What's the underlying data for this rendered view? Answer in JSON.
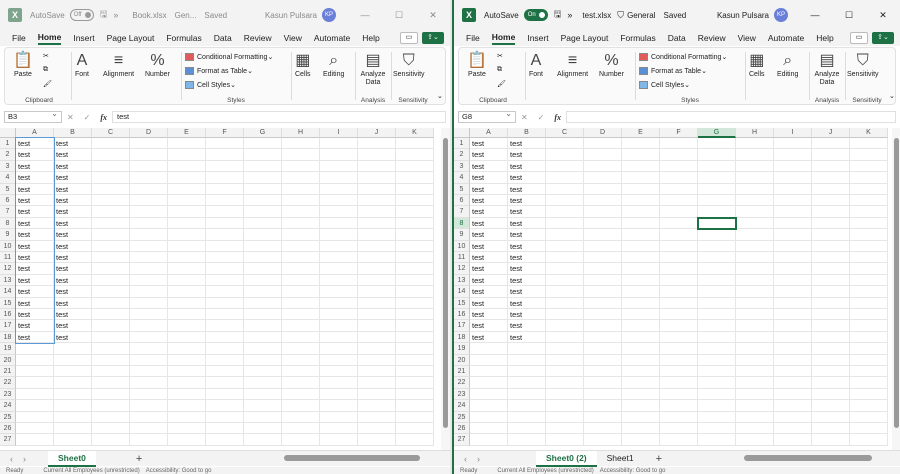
{
  "left": {
    "autosave_label": "AutoSave",
    "autosave_state": "Off",
    "filename": "Book.xlsx",
    "sensitivity": "Gen...",
    "saved_status": "Saved",
    "user": "Kasun Pulsara",
    "user_initials": "KP",
    "namebox": "B3",
    "formula": "test",
    "active_sheet": "Sheet0",
    "statusbar_ready": "Ready",
    "statusbar_text": "Current All Employees (unrestricted)",
    "statusbar_access": "Accessibility: Good to go"
  },
  "right": {
    "autosave_label": "AutoSave",
    "autosave_state": "On",
    "filename": "test.xlsx",
    "sensitivity": "General",
    "saved_status": "Saved",
    "user": "Kasun Pulsara",
    "user_initials": "KP",
    "namebox": "G8",
    "formula": "",
    "tabs": [
      "Sheet0 (2)",
      "Sheet1"
    ],
    "statusbar_ready": "Ready",
    "statusbar_text": "Current All Employees (unrestricted)",
    "statusbar_access": "Accessibility: Good to go"
  },
  "menu": [
    "File",
    "Home",
    "Insert",
    "Page Layout",
    "Formulas",
    "Data",
    "Review",
    "View",
    "Automate",
    "Help"
  ],
  "ribbon": {
    "paste": "Paste",
    "clipboard": "Clipboard",
    "font": "Font",
    "alignment": "Alignment",
    "number": "Number",
    "conditional_formatting": "Conditional Formatting",
    "format_as_table": "Format as Table",
    "cell_styles": "Cell Styles",
    "styles": "Styles",
    "cells": "Cells",
    "editing": "Editing",
    "analyze_data": "Analyze Data",
    "analysis": "Analysis",
    "sensitivity": "Sensitivity"
  },
  "columns": [
    "A",
    "B",
    "C",
    "D",
    "E",
    "F",
    "G",
    "H",
    "I",
    "J",
    "K"
  ],
  "rows": [
    "1",
    "2",
    "3",
    "4",
    "5",
    "6",
    "7",
    "8",
    "9",
    "10",
    "11",
    "12",
    "13",
    "14",
    "15",
    "16",
    "17",
    "18",
    "19",
    "20",
    "21",
    "22",
    "23",
    "24",
    "25",
    "26",
    "27"
  ],
  "cell_text": "test",
  "icons": {
    "excel": "excel-logo-icon",
    "undo": "undo-icon",
    "sensitivity": "shield-icon",
    "share": "share-icon",
    "comments": "comment-icon"
  }
}
